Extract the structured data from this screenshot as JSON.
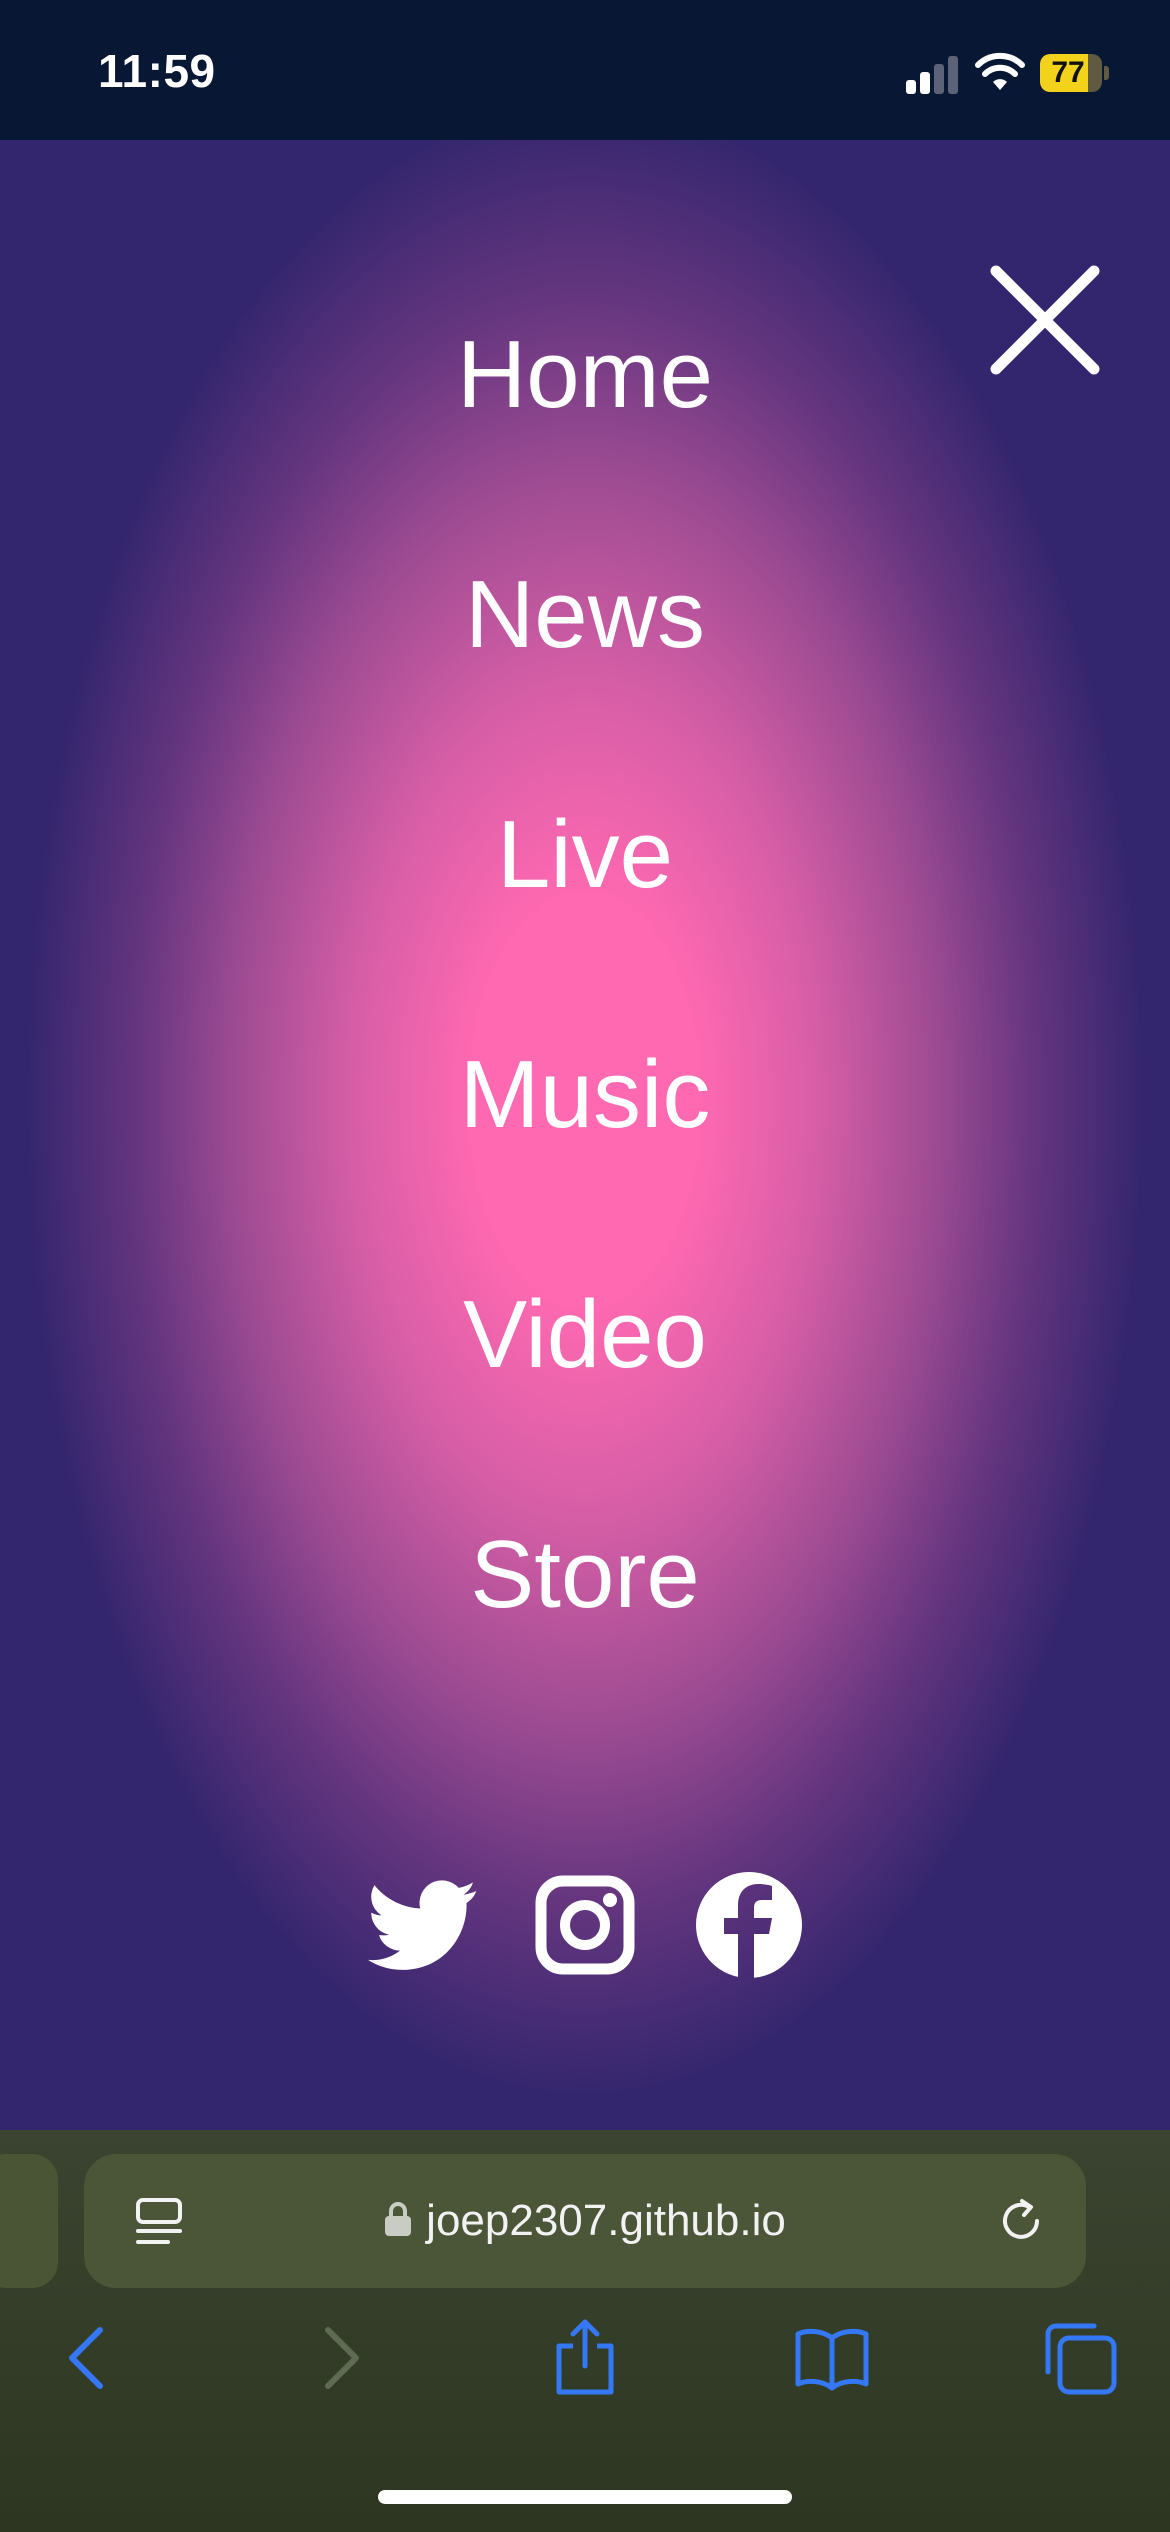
{
  "status_bar": {
    "time": "11:59",
    "battery_level": "77"
  },
  "menu": {
    "close_icon": "close-icon",
    "items": [
      {
        "label": "Home"
      },
      {
        "label": "News"
      },
      {
        "label": "Live"
      },
      {
        "label": "Music"
      },
      {
        "label": "Video"
      },
      {
        "label": "Store"
      }
    ],
    "social": [
      {
        "icon": "twitter-icon"
      },
      {
        "icon": "instagram-icon"
      },
      {
        "icon": "facebook-icon"
      }
    ]
  },
  "browser": {
    "url": "joep2307.github.io",
    "toolbar": [
      "back-icon",
      "forward-icon",
      "share-icon",
      "bookmarks-icon",
      "tabs-icon"
    ],
    "accent_color": "#3478f6"
  },
  "colors": {
    "gradient_center": "#ff69b1",
    "gradient_edge": "#33266e",
    "status_bar_bg": "#081733",
    "browser_bg": "#2c3620"
  }
}
